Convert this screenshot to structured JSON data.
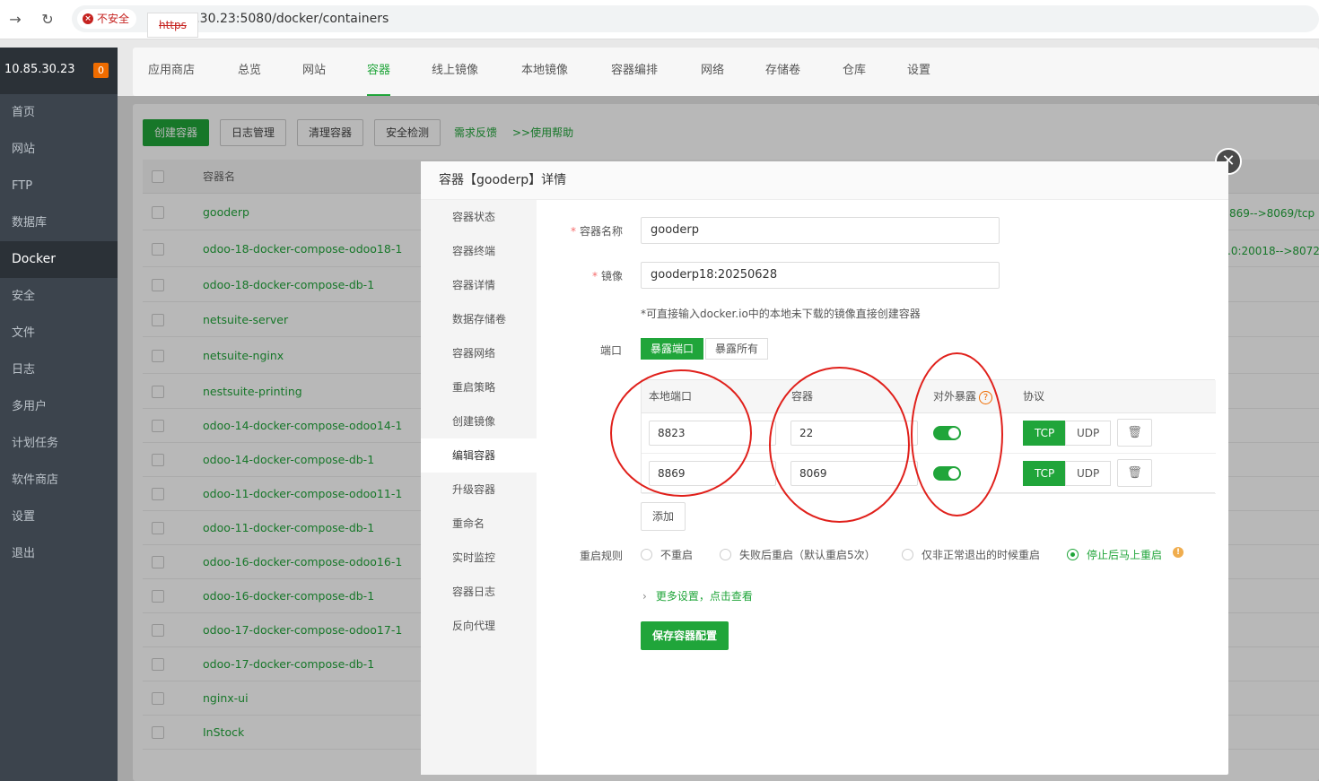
{
  "browser": {
    "insecure_label": "不安全",
    "url_proto": "https",
    "url_rest": "://10.85.30.23:5080/docker/containers"
  },
  "sidebar": {
    "host": "10.85.30.23",
    "badge": "0",
    "items": [
      {
        "label": "首页",
        "active": false
      },
      {
        "label": "网站",
        "active": false
      },
      {
        "label": "FTP",
        "active": false
      },
      {
        "label": "数据库",
        "active": false
      },
      {
        "label": "Docker",
        "active": true
      },
      {
        "label": "安全",
        "active": false
      },
      {
        "label": "文件",
        "active": false
      },
      {
        "label": "日志",
        "active": false
      },
      {
        "label": "多用户",
        "active": false
      },
      {
        "label": "计划任务",
        "active": false
      },
      {
        "label": "软件商店",
        "active": false
      },
      {
        "label": "设置",
        "active": false
      },
      {
        "label": "退出",
        "active": false
      }
    ]
  },
  "tabs": [
    {
      "label": "应用商店",
      "active": false
    },
    {
      "label": "总览",
      "active": false
    },
    {
      "label": "网站",
      "active": false
    },
    {
      "label": "容器",
      "active": true
    },
    {
      "label": "线上镜像",
      "active": false
    },
    {
      "label": "本地镜像",
      "active": false
    },
    {
      "label": "容器编排",
      "active": false
    },
    {
      "label": "网络",
      "active": false
    },
    {
      "label": "存储卷",
      "active": false
    },
    {
      "label": "仓库",
      "active": false
    },
    {
      "label": "设置",
      "active": false
    }
  ],
  "toolbar": {
    "create": "创建容器",
    "logs": "日志管理",
    "clean": "清理容器",
    "security": "安全检测",
    "feedback": "需求反馈",
    "help": ">>使用帮助"
  },
  "table": {
    "col_name": "容器名",
    "rows": [
      "gooderp",
      "odoo-18-docker-compose-odoo18-1",
      "odoo-18-docker-compose-db-1",
      "netsuite-server",
      "netsuite-nginx",
      "nestsuite-printing",
      "odoo-14-docker-compose-odoo14-1",
      "odoo-14-docker-compose-db-1",
      "odoo-11-docker-compose-odoo11-1",
      "odoo-11-docker-compose-db-1",
      "odoo-16-docker-compose-odoo16-1",
      "odoo-16-docker-compose-db-1",
      "odoo-17-docker-compose-odoo17-1",
      "odoo-17-docker-compose-db-1",
      "nginx-ui",
      "InStock"
    ],
    "port_info_1": "869-->8069/tcp",
    "port_info_2": ".0:20018-->8072/"
  },
  "modal": {
    "title": "容器【gooderp】详情",
    "nav": [
      "容器状态",
      "容器终端",
      "容器详情",
      "数据存储卷",
      "容器网络",
      "重启策略",
      "创建镜像",
      "编辑容器",
      "升级容器",
      "重命名",
      "实时监控",
      "容器日志",
      "反向代理"
    ],
    "active_nav": "编辑容器",
    "name_label": "容器名称",
    "name_value": "gooderp",
    "image_label": "镜像",
    "image_value": "gooderp18:20250628",
    "image_hint": "*可直接输入docker.io中的本地未下载的镜像直接创建容器",
    "port_label": "端口",
    "expose_port": "暴露端口",
    "expose_all": "暴露所有",
    "col_local": "本地端口",
    "col_container": "容器",
    "col_expose": "对外暴露",
    "col_protocol": "协议",
    "ports": [
      {
        "local": "8823",
        "container": "22",
        "exposed": true,
        "protocol": "TCP"
      },
      {
        "local": "8869",
        "container": "8069",
        "exposed": true,
        "protocol": "TCP"
      }
    ],
    "tcp": "TCP",
    "udp": "UDP",
    "add": "添加",
    "restart_label": "重启规则",
    "restart_options": [
      "不重启",
      "失败后重启（默认重启5次）",
      "仅非正常退出的时候重启",
      "停止后马上重启"
    ],
    "restart_selected": "停止后马上重启",
    "more": "更多设置，点击查看",
    "save": "保存容器配置"
  }
}
